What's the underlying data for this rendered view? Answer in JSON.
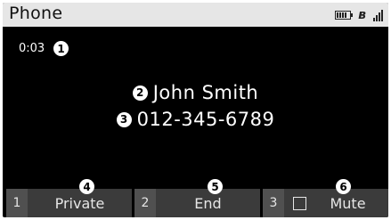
{
  "header": {
    "title": "Phone"
  },
  "status_icons": [
    "battery-icon",
    "bluetooth-icon",
    "signal-icon"
  ],
  "call": {
    "duration": "0:03",
    "name": "John Smith",
    "number": "012-345-6789"
  },
  "callouts": [
    "1",
    "2",
    "3",
    "4",
    "5",
    "6"
  ],
  "softkeys": [
    {
      "number": "1",
      "label": "Private"
    },
    {
      "number": "2",
      "label": "End"
    },
    {
      "number": "3",
      "label": "Mute",
      "checked": false
    }
  ],
  "colors": {
    "background": "#000000",
    "header": "#e6e6e6",
    "softkey": "#3b3b3b",
    "softkey_number": "#505050",
    "text": "#ffffff"
  }
}
